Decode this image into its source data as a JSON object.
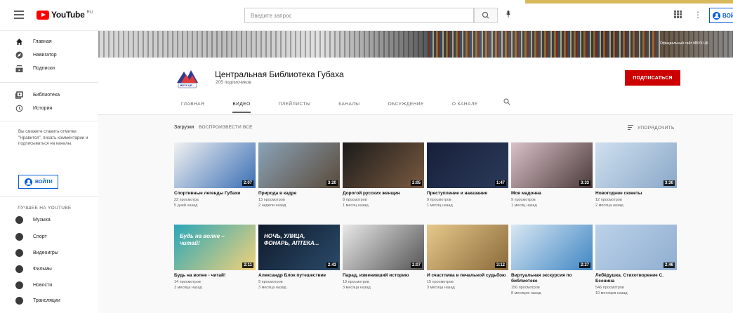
{
  "header": {
    "logo_text": "YouTube",
    "logo_country": "RU",
    "search_placeholder": "Введите запрос",
    "signin_label": "ВОЙ"
  },
  "sidebar": {
    "items": [
      {
        "label": "Главная",
        "icon": "home-icon"
      },
      {
        "label": "Навигатор",
        "icon": "compass-icon"
      },
      {
        "label": "Подписки",
        "icon": "subscriptions-icon"
      },
      {
        "label": "Библиотека",
        "icon": "library-icon"
      },
      {
        "label": "История",
        "icon": "history-icon"
      }
    ],
    "note": "Вы сможете ставить отметки \"Нравится\", писать комментарии и подписываться на каналы.",
    "login_label": "ВОЙТИ",
    "best_title": "ЛУЧШЕЕ НА YOUTUBE",
    "best": [
      {
        "label": "Музыка",
        "icon": "music-icon"
      },
      {
        "label": "Спорт",
        "icon": "sport-icon"
      },
      {
        "label": "Видеоигры",
        "icon": "gaming-icon"
      },
      {
        "label": "Фильмы",
        "icon": "movies-icon"
      },
      {
        "label": "Новости",
        "icon": "news-icon"
      },
      {
        "label": "Трансляции",
        "icon": "live-icon"
      }
    ]
  },
  "banner": {
    "caption": "Официальный сайт МБУК ЦБ"
  },
  "channel": {
    "name": "Центральная Библиотека Губаха",
    "subscribers": "205 подписчиков",
    "logo_text": "МБУК ЦБ",
    "subscribe_label": "ПОДПИСАТЬСЯ",
    "tabs": [
      "ГЛАВНАЯ",
      "ВИДЕО",
      "ПЛЕЙЛИСТЫ",
      "КАНАЛЫ",
      "ОБСУЖДЕНИЕ",
      "О КАНАЛЕ"
    ],
    "active_tab": "ВИДЕО"
  },
  "content": {
    "uploads_label": "Загрузки",
    "play_all_label": "ВОСПРОИЗВЕСТИ ВСЕ",
    "sort_label": "УПОРЯДОЧИТЬ"
  },
  "videos": [
    {
      "title": "Спортивные легенды Губахи",
      "views": "22 просмотра",
      "age": "5 дней назад",
      "duration": "2:07",
      "colors": [
        "#f1f1f1",
        "#3a6fb5"
      ]
    },
    {
      "title": "Природа в кадре",
      "views": "13 просмотров",
      "age": "2 недели назад",
      "duration": "3:20",
      "colors": [
        "#8aa3b8",
        "#5a4a3a"
      ]
    },
    {
      "title": "Дорогой русских женщин",
      "views": "8 просмотров",
      "age": "1 месяц назад",
      "duration": "2:05",
      "colors": [
        "#1b1b1b",
        "#7a5a40"
      ]
    },
    {
      "title": "Преступление и наказание",
      "views": "9 просмотров",
      "age": "1 месяц назад",
      "duration": "1:47",
      "colors": [
        "#17203a",
        "#2b3a5a"
      ]
    },
    {
      "title": "Моя мадонна",
      "views": "9 просмотров",
      "age": "1 месяц назад",
      "duration": "3:33",
      "colors": [
        "#d9c1c8",
        "#4b3a3a"
      ]
    },
    {
      "title": "Новогодние сюжеты",
      "views": "12 просмотров",
      "age": "2 месяца назад",
      "duration": "3:30",
      "colors": [
        "#cfe0ef",
        "#8aa8c8"
      ]
    },
    {
      "title": "Будь на волне - читай!",
      "views": "14 просмотров",
      "age": "3 месяца назад",
      "duration": "2:11",
      "colors": [
        "#2aa7b8",
        "#f2d27a"
      ],
      "overlay": "Будь на волне – читай!"
    },
    {
      "title": "Александр Блок путешествие",
      "views": "9 просмотров",
      "age": "3 месяца назад",
      "duration": "2:43",
      "colors": [
        "#0f1a2a",
        "#2b4a6a"
      ],
      "overlay": "НОЧЬ, УЛИЦА, ФОНАРЬ, АПТЕКА..."
    },
    {
      "title": "Парад, изменивший историю",
      "views": "19 просмотров",
      "age": "3 месяца назад",
      "duration": "2:07",
      "colors": [
        "#e8e8e8",
        "#555555"
      ]
    },
    {
      "title": "И счастлива в печальной судьбою",
      "views": "15 просмотров",
      "age": "3 месяца назад",
      "duration": "3:12",
      "colors": [
        "#e7c88a",
        "#8a6a3a"
      ]
    },
    {
      "title": "Виртуальная экскурсия по библиотеке",
      "views": "156 просмотров",
      "age": "8 месяцев назад",
      "duration": "2:27",
      "colors": [
        "#d9e7f2",
        "#3f86c4"
      ]
    },
    {
      "title": "Лебёдушка. Стихотворение С. Есенина",
      "views": "546 просмотров",
      "age": "10 месяцев назад",
      "duration": "2:46",
      "colors": [
        "#bcd2ea",
        "#8faed0"
      ]
    }
  ]
}
